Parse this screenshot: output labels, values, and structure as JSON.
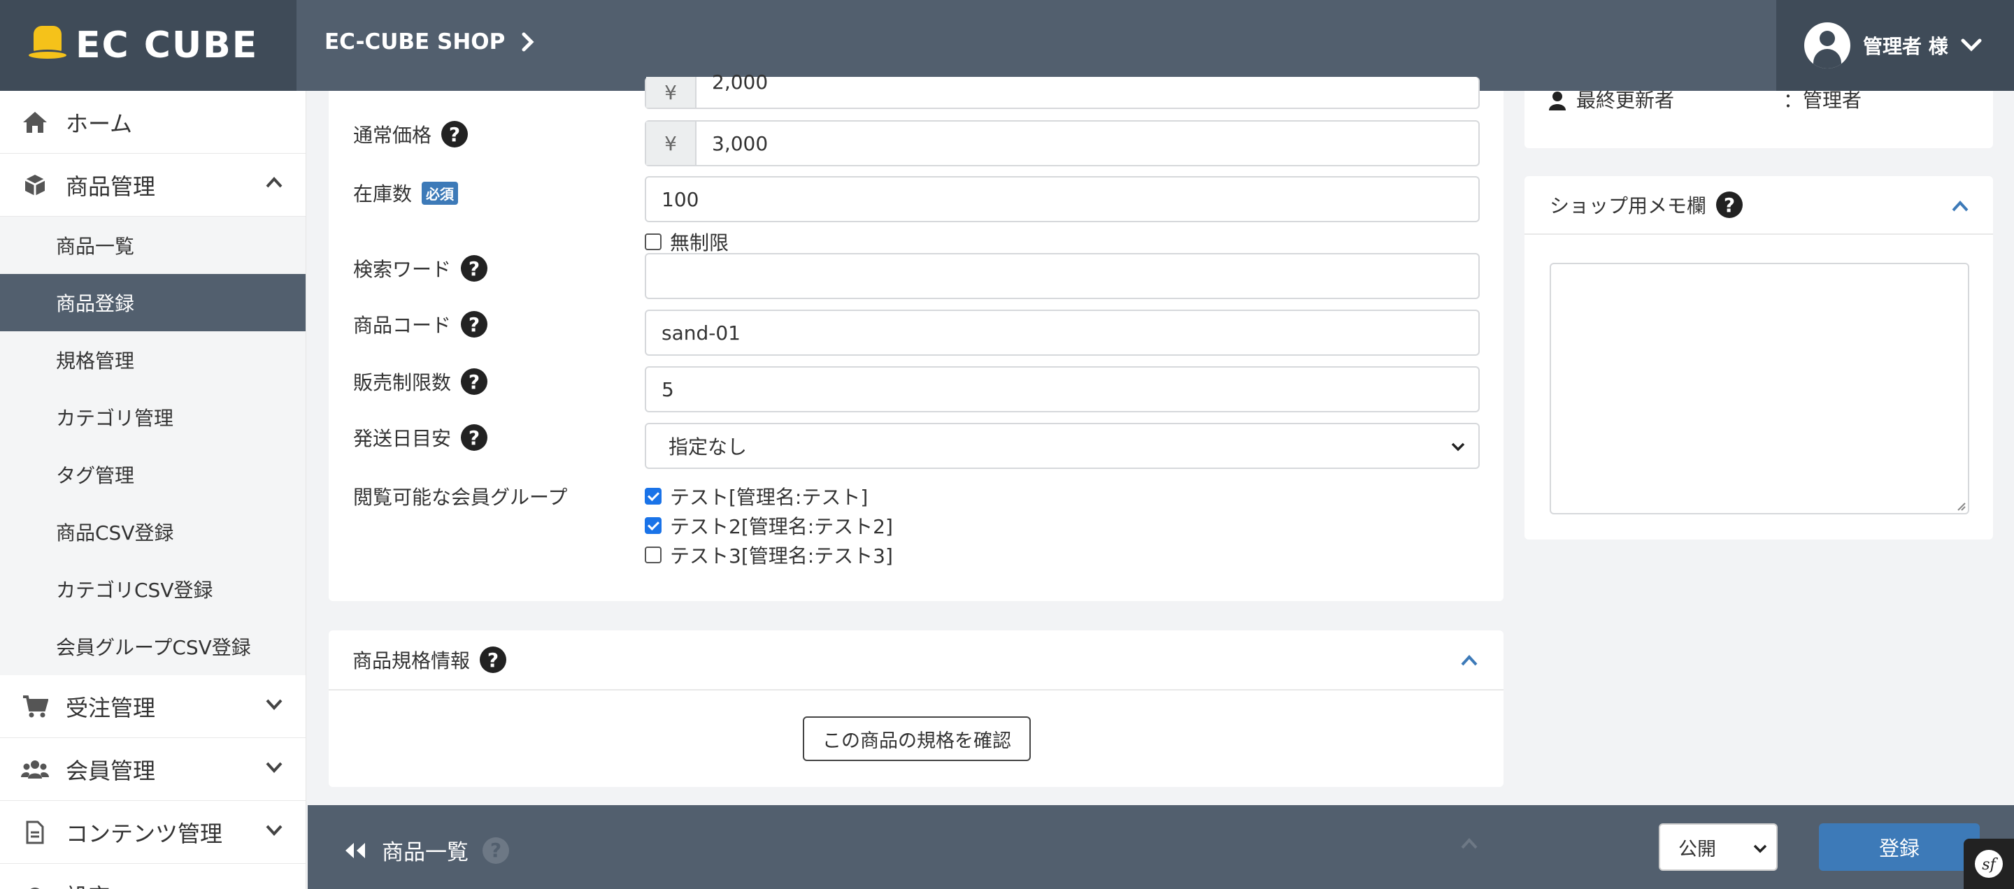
{
  "header": {
    "logo": "EC CUBE",
    "shop_name": "EC-CUBE SHOP",
    "user_label": "管理者 様"
  },
  "sidebar": {
    "home": "ホーム",
    "product": "商品管理",
    "product_items": [
      "商品一覧",
      "商品登録",
      "規格管理",
      "カテゴリ管理",
      "タグ管理",
      "商品CSV登録",
      "カテゴリCSV登録",
      "会員グループCSV登録"
    ],
    "order": "受注管理",
    "customer": "会員管理",
    "content": "コンテンツ管理",
    "settings": "設定"
  },
  "form": {
    "partial_price": "2,000",
    "regular_price_label": "通常価格",
    "regular_price": "3,000",
    "currency": "¥",
    "stock_label": "在庫数",
    "required_badge": "必須",
    "stock_value": "100",
    "unlimited_label": "無制限",
    "search_word_label": "検索ワード",
    "search_word_value": "",
    "product_code_label": "商品コード",
    "product_code_value": "sand-01",
    "sale_limit_label": "販売制限数",
    "sale_limit_value": "5",
    "delivery_label": "発送日目安",
    "delivery_value": "指定なし",
    "group_label": "閲覧可能な会員グループ",
    "groups": [
      {
        "label": "テスト[管理名:テスト]",
        "checked": true
      },
      {
        "label": "テスト2[管理名:テスト2]",
        "checked": true
      },
      {
        "label": "テスト3[管理名:テスト3]",
        "checked": false
      }
    ]
  },
  "spec_section": {
    "title": "商品規格情報",
    "button": "この商品の規格を確認"
  },
  "right_panel": {
    "last_editor_label": "最終更新者",
    "last_editor_value": "：管理者",
    "memo_title": "ショップ用メモ欄"
  },
  "bottom": {
    "back_label": "商品一覧",
    "status": "公開",
    "submit": "登録"
  },
  "colors": {
    "header": "#525f6e",
    "dark": "#3f4b58",
    "primary": "#3d7ab8"
  }
}
